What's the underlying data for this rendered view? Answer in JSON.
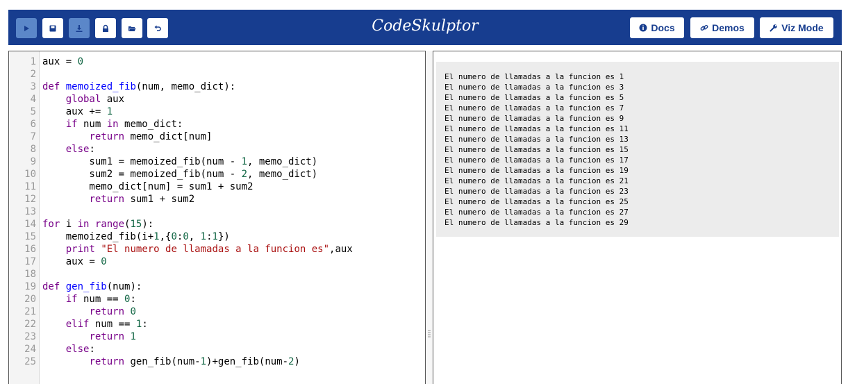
{
  "toolbar": {
    "buttons": [
      {
        "name": "run-button",
        "icon": "play-icon"
      },
      {
        "name": "save-button",
        "icon": "save-icon"
      },
      {
        "name": "download-button",
        "icon": "download-icon"
      },
      {
        "name": "fresh-url-button",
        "icon": "lock-icon"
      },
      {
        "name": "open-button",
        "icon": "folder-open-icon"
      },
      {
        "name": "reset-button",
        "icon": "undo-icon"
      }
    ],
    "brand": "CodeSkulptor",
    "docs_label": "Docs",
    "demos_label": "Demos",
    "viz_label": "Viz Mode"
  },
  "colors": {
    "header": "#173d8f",
    "active_button": "#5b87c9",
    "keyword": "#770088",
    "def_name": "#0000ff",
    "number": "#116644",
    "string": "#aa1111"
  },
  "editor": {
    "lines": [
      [
        [
          "t",
          "aux = "
        ],
        [
          "num",
          "0"
        ]
      ],
      [],
      [
        [
          "kw",
          "def"
        ],
        [
          "t",
          " "
        ],
        [
          "fn",
          "memoized_fib"
        ],
        [
          "t",
          "(num, memo_dict):"
        ]
      ],
      [
        [
          "t",
          "    "
        ],
        [
          "kw",
          "global"
        ],
        [
          "t",
          " aux"
        ]
      ],
      [
        [
          "t",
          "    aux += "
        ],
        [
          "num",
          "1"
        ]
      ],
      [
        [
          "t",
          "    "
        ],
        [
          "kw",
          "if"
        ],
        [
          "t",
          " num "
        ],
        [
          "kw",
          "in"
        ],
        [
          "t",
          " memo_dict:"
        ]
      ],
      [
        [
          "t",
          "        "
        ],
        [
          "kw",
          "return"
        ],
        [
          "t",
          " memo_dict[num]"
        ]
      ],
      [
        [
          "t",
          "    "
        ],
        [
          "kw",
          "else"
        ],
        [
          "t",
          ":"
        ]
      ],
      [
        [
          "t",
          "        sum1 = memoized_fib(num - "
        ],
        [
          "num",
          "1"
        ],
        [
          "t",
          ", memo_dict)"
        ]
      ],
      [
        [
          "t",
          "        sum2 = memoized_fib(num - "
        ],
        [
          "num",
          "2"
        ],
        [
          "t",
          ", memo_dict)"
        ]
      ],
      [
        [
          "t",
          "        memo_dict[num] = sum1 + sum2"
        ]
      ],
      [
        [
          "t",
          "        "
        ],
        [
          "kw",
          "return"
        ],
        [
          "t",
          " sum1 + sum2"
        ]
      ],
      [],
      [
        [
          "kw",
          "for"
        ],
        [
          "t",
          " i "
        ],
        [
          "kw",
          "in"
        ],
        [
          "t",
          " "
        ],
        [
          "kw",
          "range"
        ],
        [
          "t",
          "("
        ],
        [
          "num",
          "15"
        ],
        [
          "t",
          "):"
        ]
      ],
      [
        [
          "t",
          "    memoized_fib(i+"
        ],
        [
          "num",
          "1"
        ],
        [
          "t",
          ",{"
        ],
        [
          "num",
          "0"
        ],
        [
          "t",
          ":"
        ],
        [
          "num",
          "0"
        ],
        [
          "t",
          ", "
        ],
        [
          "num",
          "1"
        ],
        [
          "t",
          ":"
        ],
        [
          "num",
          "1"
        ],
        [
          "t",
          "})"
        ]
      ],
      [
        [
          "t",
          "    "
        ],
        [
          "kw",
          "print"
        ],
        [
          "t",
          " "
        ],
        [
          "str",
          "\"El numero de llamadas a la funcion es\""
        ],
        [
          "t",
          ",aux"
        ]
      ],
      [
        [
          "t",
          "    aux = "
        ],
        [
          "num",
          "0"
        ]
      ],
      [],
      [
        [
          "kw",
          "def"
        ],
        [
          "t",
          " "
        ],
        [
          "fn",
          "gen_fib"
        ],
        [
          "t",
          "(num):"
        ]
      ],
      [
        [
          "t",
          "    "
        ],
        [
          "kw",
          "if"
        ],
        [
          "t",
          " num == "
        ],
        [
          "num",
          "0"
        ],
        [
          "t",
          ":"
        ]
      ],
      [
        [
          "t",
          "        "
        ],
        [
          "kw",
          "return"
        ],
        [
          "t",
          " "
        ],
        [
          "num",
          "0"
        ]
      ],
      [
        [
          "t",
          "    "
        ],
        [
          "kw",
          "elif"
        ],
        [
          "t",
          " num == "
        ],
        [
          "num",
          "1"
        ],
        [
          "t",
          ":"
        ]
      ],
      [
        [
          "t",
          "        "
        ],
        [
          "kw",
          "return"
        ],
        [
          "t",
          " "
        ],
        [
          "num",
          "1"
        ]
      ],
      [
        [
          "t",
          "    "
        ],
        [
          "kw",
          "else"
        ],
        [
          "t",
          ":"
        ]
      ],
      [
        [
          "t",
          "        "
        ],
        [
          "kw",
          "return"
        ],
        [
          "t",
          " gen_fib(num-"
        ],
        [
          "num",
          "1"
        ],
        [
          "t",
          ")+gen_fib(num-"
        ],
        [
          "num",
          "2"
        ],
        [
          "t",
          ")"
        ]
      ]
    ]
  },
  "output": {
    "lines": [
      "El numero de llamadas a la funcion es 1",
      "El numero de llamadas a la funcion es 3",
      "El numero de llamadas a la funcion es 5",
      "El numero de llamadas a la funcion es 7",
      "El numero de llamadas a la funcion es 9",
      "El numero de llamadas a la funcion es 11",
      "El numero de llamadas a la funcion es 13",
      "El numero de llamadas a la funcion es 15",
      "El numero de llamadas a la funcion es 17",
      "El numero de llamadas a la funcion es 19",
      "El numero de llamadas a la funcion es 21",
      "El numero de llamadas a la funcion es 23",
      "El numero de llamadas a la funcion es 25",
      "El numero de llamadas a la funcion es 27",
      "El numero de llamadas a la funcion es 29"
    ]
  }
}
